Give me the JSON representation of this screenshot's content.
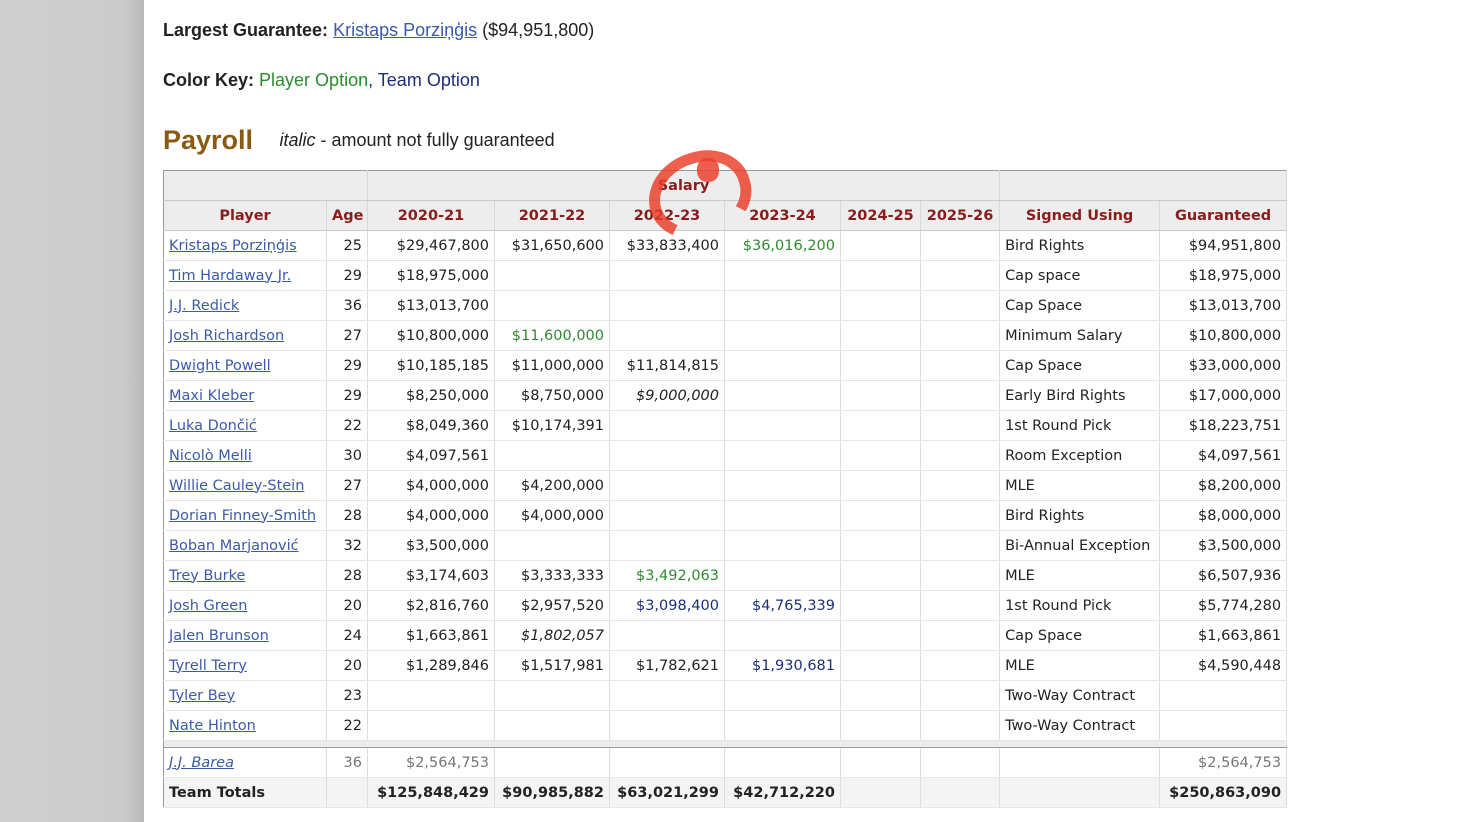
{
  "summary": {
    "guarantee_label": "Largest Guarantee:",
    "guarantee_player": "Kristaps Porziņģis",
    "guarantee_amount": "($94,951,800)",
    "colorkey_label": "Color Key:",
    "player_option": "Player Option",
    "comma": ",",
    "team_option": "Team Option"
  },
  "payroll": {
    "title": "Payroll",
    "italic_word": "italic",
    "note": " - amount not fully guaranteed"
  },
  "table": {
    "group_header": "Salary",
    "headers": [
      "Player",
      "Age",
      "2020-21",
      "2021-22",
      "2022-23",
      "2023-24",
      "2024-25",
      "2025-26",
      "Signed Using",
      "Guaranteed"
    ],
    "rows": [
      {
        "player": "Kristaps Porziņģis",
        "age": "25",
        "y1": "$29,467,800",
        "y2": "$31,650,600",
        "y3": "$33,833,400",
        "y4": "$36,016,200",
        "y5": "",
        "y6": "",
        "signed": "Bird Rights",
        "guaranteed": "$94,951,800"
      },
      {
        "player": "Tim Hardaway Jr.",
        "age": "29",
        "y1": "$18,975,000",
        "y2": "",
        "y3": "",
        "y4": "",
        "y5": "",
        "y6": "",
        "signed": "Cap space",
        "guaranteed": "$18,975,000"
      },
      {
        "player": "J.J. Redick",
        "age": "36",
        "y1": "$13,013,700",
        "y2": "",
        "y3": "",
        "y4": "",
        "y5": "",
        "y6": "",
        "signed": "Cap Space",
        "guaranteed": "$13,013,700"
      },
      {
        "player": "Josh Richardson",
        "age": "27",
        "y1": "$10,800,000",
        "y2": "$11,600,000",
        "y3": "",
        "y4": "",
        "y5": "",
        "y6": "",
        "signed": "Minimum Salary",
        "guaranteed": "$10,800,000"
      },
      {
        "player": "Dwight Powell",
        "age": "29",
        "y1": "$10,185,185",
        "y2": "$11,000,000",
        "y3": "$11,814,815",
        "y4": "",
        "y5": "",
        "y6": "",
        "signed": "Cap Space",
        "guaranteed": "$33,000,000"
      },
      {
        "player": "Maxi Kleber",
        "age": "29",
        "y1": "$8,250,000",
        "y2": "$8,750,000",
        "y3": "$9,000,000",
        "y4": "",
        "y5": "",
        "y6": "",
        "signed": "Early Bird Rights",
        "guaranteed": "$17,000,000"
      },
      {
        "player": "Luka Dončić",
        "age": "22",
        "y1": "$8,049,360",
        "y2": "$10,174,391",
        "y3": "",
        "y4": "",
        "y5": "",
        "y6": "",
        "signed": "1st Round Pick",
        "guaranteed": "$18,223,751"
      },
      {
        "player": "Nicolò Melli",
        "age": "30",
        "y1": "$4,097,561",
        "y2": "",
        "y3": "",
        "y4": "",
        "y5": "",
        "y6": "",
        "signed": "Room Exception",
        "guaranteed": "$4,097,561"
      },
      {
        "player": "Willie Cauley-Stein",
        "age": "27",
        "y1": "$4,000,000",
        "y2": "$4,200,000",
        "y3": "",
        "y4": "",
        "y5": "",
        "y6": "",
        "signed": "MLE",
        "guaranteed": "$8,200,000"
      },
      {
        "player": "Dorian Finney-Smith",
        "age": "28",
        "y1": "$4,000,000",
        "y2": "$4,000,000",
        "y3": "",
        "y4": "",
        "y5": "",
        "y6": "",
        "signed": "Bird Rights",
        "guaranteed": "$8,000,000"
      },
      {
        "player": "Boban Marjanović",
        "age": "32",
        "y1": "$3,500,000",
        "y2": "",
        "y3": "",
        "y4": "",
        "y5": "",
        "y6": "",
        "signed": "Bi-Annual Exception",
        "guaranteed": "$3,500,000"
      },
      {
        "player": "Trey Burke",
        "age": "28",
        "y1": "$3,174,603",
        "y2": "$3,333,333",
        "y3": "$3,492,063",
        "y4": "",
        "y5": "",
        "y6": "",
        "signed": "MLE",
        "guaranteed": "$6,507,936"
      },
      {
        "player": "Josh Green",
        "age": "20",
        "y1": "$2,816,760",
        "y2": "$2,957,520",
        "y3": "$3,098,400",
        "y4": "$4,765,339",
        "y5": "",
        "y6": "",
        "signed": "1st Round Pick",
        "guaranteed": "$5,774,280"
      },
      {
        "player": "Jalen Brunson",
        "age": "24",
        "y1": "$1,663,861",
        "y2": "$1,802,057",
        "y3": "",
        "y4": "",
        "y5": "",
        "y6": "",
        "signed": "Cap Space",
        "guaranteed": "$1,663,861"
      },
      {
        "player": "Tyrell Terry",
        "age": "20",
        "y1": "$1,289,846",
        "y2": "$1,517,981",
        "y3": "$1,782,621",
        "y4": "$1,930,681",
        "y5": "",
        "y6": "",
        "signed": "MLE",
        "guaranteed": "$4,590,448"
      },
      {
        "player": "Tyler Bey",
        "age": "23",
        "y1": "",
        "y2": "",
        "y3": "",
        "y4": "",
        "y5": "",
        "y6": "",
        "signed": "Two-Way Contract",
        "guaranteed": ""
      },
      {
        "player": "Nate Hinton",
        "age": "22",
        "y1": "",
        "y2": "",
        "y3": "",
        "y4": "",
        "y5": "",
        "y6": "",
        "signed": "Two-Way Contract",
        "guaranteed": ""
      }
    ],
    "dead": {
      "player": "J.J. Barea",
      "age": "36",
      "y1": "$2,564,753",
      "guaranteed": "$2,564,753"
    },
    "totals": {
      "label": "Team Totals",
      "y1": "$125,848,429",
      "y2": "$90,985,882",
      "y3": "$63,021,299",
      "y4": "$42,712,220",
      "guaranteed": "$250,863,090"
    }
  },
  "colors": {
    "player_option": "#2e8b2e",
    "team_option": "#1c2f7a",
    "header_text": "#8a1c1c",
    "title": "#8a5a12",
    "annotation_circle": "#eb3c28"
  }
}
